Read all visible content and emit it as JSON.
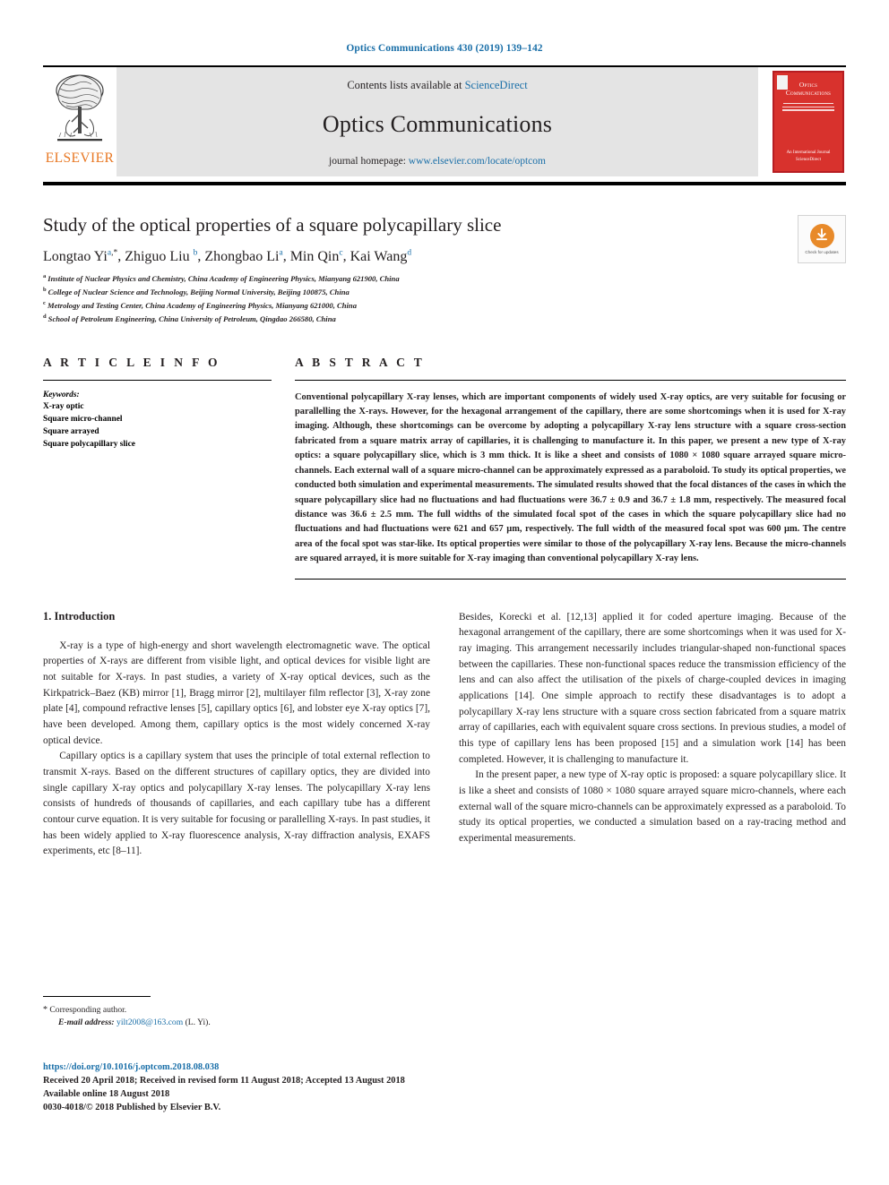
{
  "running_head": "Optics Communications 430 (2019) 139–142",
  "masthead": {
    "contents_prefix": "Contents lists available at ",
    "contents_link": "ScienceDirect",
    "journal_name": "Optics Communications",
    "homepage_prefix": "journal homepage: ",
    "homepage_link": "www.elsevier.com/locate/optcom",
    "publisher": "ELSEVIER",
    "cover": {
      "title_line1": "Optics",
      "title_line2": "Communications",
      "footer_line1": "An International Journal",
      "footer_line2": "ScienceDirect"
    }
  },
  "article": {
    "title": "Study of the optical properties of a square polycapillary slice",
    "authors": [
      {
        "name": "Longtao Yi",
        "marks": "a",
        "corresponding": true
      },
      {
        "name": "Zhiguo Liu",
        "marks": "b",
        "corresponding": false
      },
      {
        "name": "Zhongbao Li",
        "marks": "a",
        "corresponding": false
      },
      {
        "name": "Min Qin",
        "marks": "c",
        "corresponding": false
      },
      {
        "name": "Kai Wang",
        "marks": "d",
        "corresponding": false
      }
    ],
    "affiliations": [
      {
        "mark": "a",
        "text": "Institute of Nuclear Physics and Chemistry, China Academy of Engineering Physics, Mianyang 621900, China"
      },
      {
        "mark": "b",
        "text": "College of Nuclear Science and Technology, Beijing Normal University, Beijing 100875, China"
      },
      {
        "mark": "c",
        "text": "Metrology and Testing Center, China Academy of Engineering Physics, Mianyang 621000, China"
      },
      {
        "mark": "d",
        "text": "School of Petroleum Engineering, China University of Petroleum, Qingdao 266580, China"
      }
    ],
    "crossmark_label": "Check for updates"
  },
  "article_info": {
    "heading": "A R T I C L E   I N F O",
    "keywords_label": "Keywords:",
    "keywords": [
      "X-ray optic",
      "Square micro-channel",
      "Square arrayed",
      "Square polycapillary slice"
    ]
  },
  "abstract": {
    "heading": "A B S T R A C T",
    "text": "Conventional polycapillary X-ray lenses, which are important components of widely used X-ray optics, are very suitable for focusing or parallelling the X-rays. However, for the hexagonal arrangement of the capillary, there are some shortcomings when it is used for X-ray imaging. Although, these shortcomings can be overcome by adopting a polycapillary X-ray lens structure with a square cross-section fabricated from a square matrix array of capillaries, it is challenging to manufacture it. In this paper, we present a new type of X-ray optics: a square polycapillary slice, which is 3 mm thick. It is like a sheet and consists of 1080 × 1080 square arrayed square micro-channels. Each external wall of a square micro-channel can be approximately expressed as a paraboloid. To study its optical properties, we conducted both simulation and experimental measurements. The simulated results showed that the focal distances of the cases in which the square polycapillary slice had no fluctuations and had fluctuations were 36.7 ± 0.9 and 36.7 ± 1.8 mm, respectively. The measured focal distance was 36.6 ± 2.5 mm. The full widths of the simulated focal spot of the cases in which the square polycapillary slice had no fluctuations and had fluctuations were 621 and 657 µm, respectively. The full width of the measured focal spot was 600 µm. The centre area of the focal spot was star-like. Its optical properties were similar to those of the polycapillary X-ray lens. Because the micro-channels are squared arrayed, it is more suitable for X-ray imaging than conventional polycapillary X-ray lens."
  },
  "introduction": {
    "heading": "1.  Introduction",
    "left_paragraphs": [
      "X-ray is a type of high-energy and short wavelength  electromagnetic wave. The optical properties of X-rays are different from visible light, and optical devices for visible light are not suitable for X-rays. In past studies, a variety of X-ray optical devices, such as the Kirkpatrick–Baez (KB) mirror [1], Bragg mirror [2], multilayer film reflector [3], X-ray zone plate [4], compound refractive lenses [5], capillary optics [6], and lobster eye X-ray optics [7], have been developed. Among them, capillary optics is the most widely concerned X-ray optical device.",
      "Capillary optics is a capillary system that uses the principle of total external reflection to transmit X-rays. Based on the different structures of capillary optics, they are divided into single capillary X-ray optics and polycapillary X-ray lenses. The polycapillary X-ray lens consists of hundreds of thousands of capillaries, and each capillary tube has a different contour curve equation. It is very suitable for focusing or parallelling X-rays. In past studies, it has been widely applied to X-ray fluorescence analysis, X-ray diffraction analysis, EXAFS experiments, etc [8–11]."
    ],
    "right_paragraphs": [
      "Besides, Korecki et al. [12,13] applied it for coded aperture imaging. Because of the hexagonal arrangement of the capillary, there are some shortcomings when it was used for X-ray imaging. This arrangement necessarily includes triangular-shaped non-functional spaces between the capillaries. These non-functional spaces reduce the transmission efficiency of the lens and can also affect the utilisation of the pixels of charge-coupled devices in imaging applications [14]. One simple approach to rectify these disadvantages is to adopt a polycapillary X-ray lens structure with a square cross section fabricated from a square matrix array of capillaries, each with equivalent square cross sections. In previous studies, a model of this type of capillary lens has been proposed [15] and a simulation work [14] has been completed. However, it is challenging to manufacture it.",
      "In the present paper, a new type of X-ray optic is proposed: a square polycapillary slice. It is like a sheet and consists of 1080 × 1080 square arrayed square micro-channels, where each external wall of the square micro-channels can be approximately expressed as a paraboloid. To study its optical properties, we conducted a simulation based on a ray-tracing method and experimental measurements."
    ]
  },
  "footnotes": {
    "corresponding_marker": "*",
    "corresponding_text": "Corresponding author.",
    "email_label": "E-mail address:",
    "email": "yilt2008@163.com",
    "email_suffix": "(L. Yi)."
  },
  "footer": {
    "doi": "https://doi.org/10.1016/j.optcom.2018.08.038",
    "received": "Received 20 April 2018; Received in revised form 11 August 2018; Accepted 13 August 2018",
    "available": "Available online 18 August 2018",
    "copyright": "0030-4018/© 2018 Published by Elsevier B.V."
  },
  "colors": {
    "link": "#1a6fa8",
    "elsevier_orange": "#e87722",
    "cover_red": "#d8322d",
    "masthead_grey": "#e4e4e4"
  }
}
